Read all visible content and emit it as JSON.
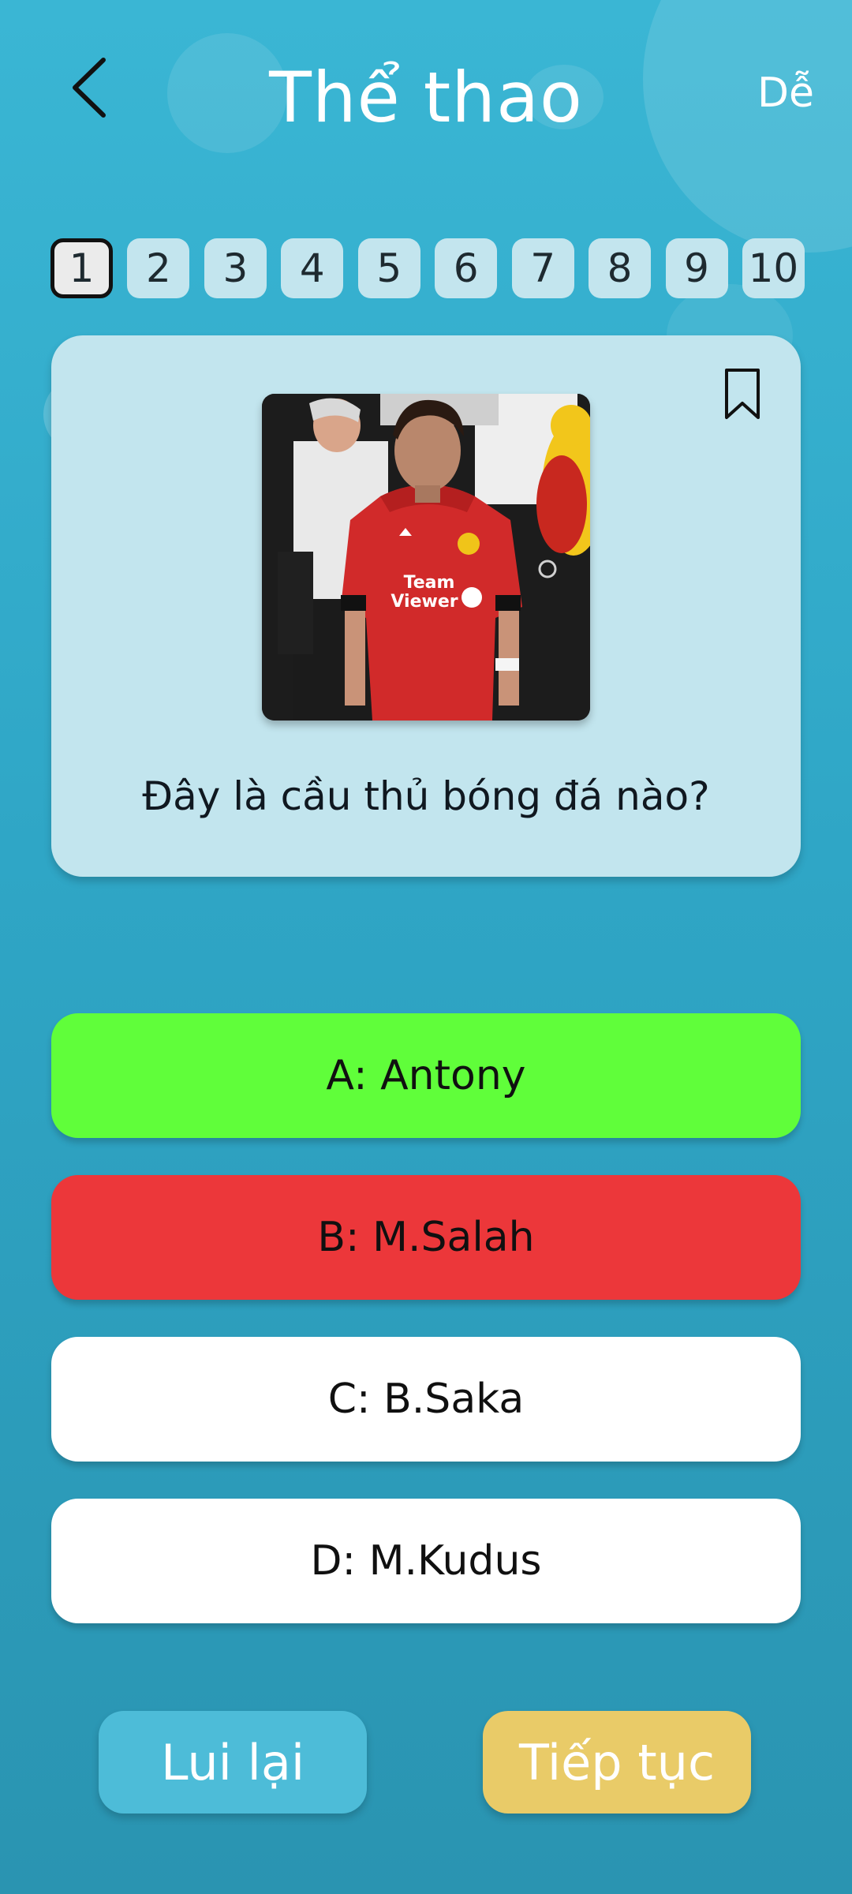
{
  "header": {
    "back_icon": "chevron-left-icon",
    "title": "Thể thao",
    "difficulty": "Dễ"
  },
  "question_nav": {
    "active": "1",
    "items": [
      "1",
      "2",
      "3",
      "4",
      "5",
      "6",
      "7",
      "8",
      "9",
      "10"
    ]
  },
  "question": {
    "bookmark_icon": "bookmark-icon",
    "text": "Đây là cầu thủ bóng đá nào?",
    "image": {
      "shirt_sponsor": "Team Viewer"
    }
  },
  "answers": [
    {
      "label": "A: Antony",
      "state": "correct",
      "color": "#60fe3a"
    },
    {
      "label": "B: M.Salah",
      "state": "wrong",
      "color": "#ec373a"
    },
    {
      "label": "C: B.Saka",
      "state": "neutral",
      "color": "#ffffff"
    },
    {
      "label": "D: M.Kudus",
      "state": "neutral",
      "color": "#ffffff"
    }
  ],
  "footer": {
    "back_label": "Lui lại",
    "next_label": "Tiếp tục"
  },
  "colors": {
    "background": "#34abc9",
    "card": "#c2e5ee",
    "back_button": "#4dbcd8",
    "next_button": "#e9cb68"
  }
}
